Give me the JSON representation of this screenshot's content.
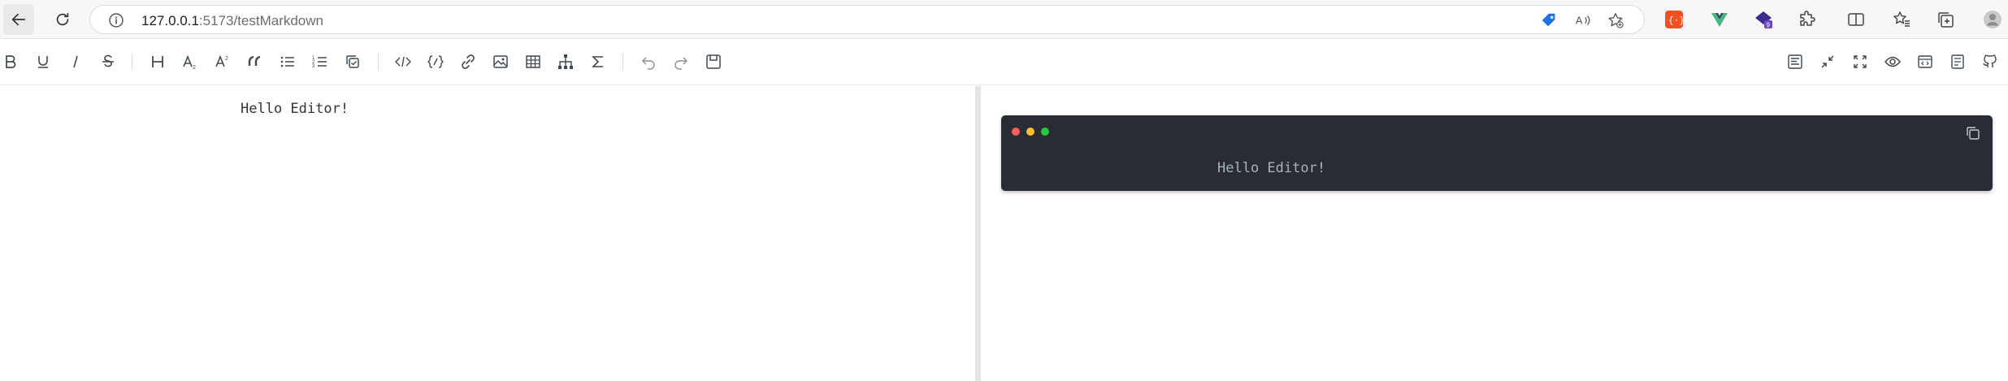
{
  "browser": {
    "url_host": "127.0.0.1",
    "url_path": ":5173/testMarkdown"
  },
  "toolbar": {
    "left_tools": [
      "bold",
      "underline",
      "italic",
      "strikethrough",
      "title",
      "sub",
      "sup",
      "quote",
      "unordered-list",
      "ordered-list",
      "task",
      "code-row",
      "code",
      "link",
      "image",
      "table",
      "mermaid",
      "katex",
      "revoke",
      "next",
      "save"
    ],
    "right_tools": [
      "prettier",
      "page-fullscreen",
      "fullscreen",
      "preview",
      "html-preview",
      "catalog",
      "github"
    ]
  },
  "editor": {
    "content": "            Hello Editor!"
  },
  "preview": {
    "code_content": "            Hello Editor!"
  },
  "colors": {
    "code_bg": "#282c34",
    "code_text": "#abb2bf",
    "dot_red": "#fe5f56",
    "dot_yellow": "#ffbd2e",
    "dot_green": "#28c940"
  }
}
